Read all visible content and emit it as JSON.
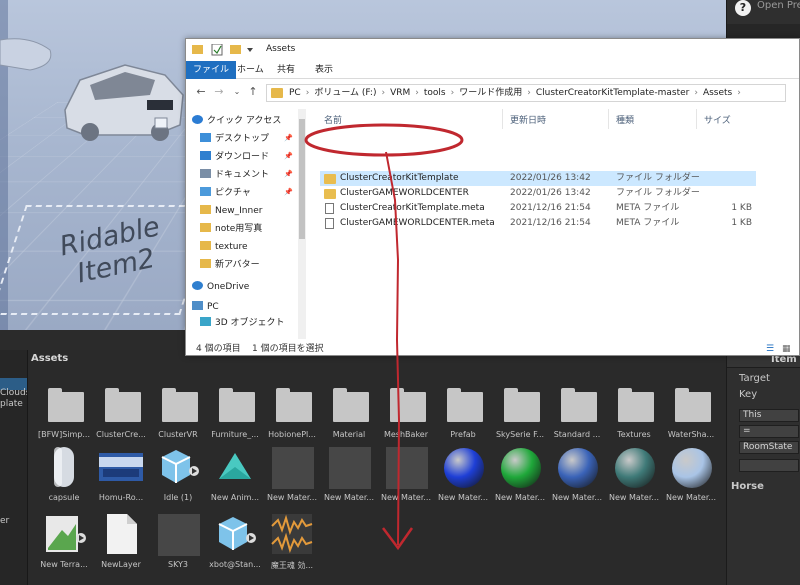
{
  "scene": {
    "ridable_label_line1": "Ridable",
    "ridable_label_line2": "Item2"
  },
  "inspector": {
    "help_icon": "?",
    "open_prefab": "Open Prefab",
    "item_header": "Item Lo",
    "target_label": "Target",
    "key_label": "Key",
    "this_field": "This",
    "equals_field": "=",
    "roomstate_field": "RoomState",
    "horse_header": "Horse"
  },
  "hierarchy": {
    "items": [
      "Clouds",
      "plate",
      "er"
    ]
  },
  "explorer": {
    "title": "Assets",
    "ribbon_tabs": [
      "ファイル",
      "ホーム",
      "共有",
      "表示"
    ],
    "address_path": [
      "PC",
      "ボリューム (F:)",
      "VRM",
      "tools",
      "ワールド作成用",
      "ClusterCreatorKitTemplate-master",
      "Assets"
    ],
    "nav_items": [
      {
        "label": "クイック アクセス",
        "icon": "star-icon",
        "pinned": false
      },
      {
        "label": "デスクトップ",
        "icon": "desktop-icon",
        "pinned": true
      },
      {
        "label": "ダウンロード",
        "icon": "download-icon",
        "pinned": true
      },
      {
        "label": "ドキュメント",
        "icon": "document-icon",
        "pinned": true
      },
      {
        "label": "ピクチャ",
        "icon": "picture-icon",
        "pinned": true
      },
      {
        "label": "New_Inner",
        "icon": "folder-icon",
        "pinned": false
      },
      {
        "label": "note用写真",
        "icon": "folder-icon",
        "pinned": false
      },
      {
        "label": "texture",
        "icon": "folder-icon",
        "pinned": false
      },
      {
        "label": "新アバター",
        "icon": "folder-icon",
        "pinned": false
      },
      {
        "label": "OneDrive",
        "icon": "cloud-icon",
        "pinned": false
      },
      {
        "label": "PC",
        "icon": "pc-icon",
        "pinned": false
      },
      {
        "label": "3D オブジェクト",
        "icon": "3d-objects-icon",
        "pinned": false
      }
    ],
    "columns": {
      "name": "名前",
      "date": "更新日時",
      "type": "種類",
      "size": "サイズ"
    },
    "files": [
      {
        "name": "ClusterCreatorKitTemplate",
        "date": "2022/01/26 13:42",
        "type": "ファイル フォルダー",
        "size": "",
        "kind": "folder"
      },
      {
        "name": "ClusterGAMEWORLDCENTER",
        "date": "2022/01/26 13:42",
        "type": "ファイル フォルダー",
        "size": "",
        "kind": "folder"
      },
      {
        "name": "ClusterCreatorKitTemplate.meta",
        "date": "2021/12/16 21:54",
        "type": "META ファイル",
        "size": "1 KB",
        "kind": "file"
      },
      {
        "name": "ClusterGAMEWORLDCENTER.meta",
        "date": "2021/12/16 21:54",
        "type": "META ファイル",
        "size": "1 KB",
        "kind": "file"
      }
    ],
    "status_count": "4 個の項目",
    "status_selected": "1 個の項目を選択"
  },
  "assets": {
    "title": "Assets",
    "row1": [
      "[BFW]Simp...",
      "ClusterCre...",
      "ClusterVR",
      "Furniture_...",
      "HobionePl...",
      "Material",
      "MeshBaker",
      "Prefab",
      "SkySerie F...",
      "Standard ...",
      "Textures",
      "WaterSha..."
    ],
    "row2": [
      "capsule",
      "Homu-Ro...",
      "Idle (1)",
      "New Anim...",
      "New Mater...",
      "New Mater...",
      "New Mater...",
      "New Mater...",
      "New Mater...",
      "New Mater...",
      "New Mater...",
      "New Mater..."
    ],
    "row3": [
      "New Terra...",
      "NewLayer",
      "SKY3",
      "xbot@Stan...",
      "魔王魂 効..."
    ],
    "sphere_colors": [
      "#1e3fd6",
      "#1fa83a",
      "#3a63b8",
      "#3f7a78",
      "#a9c4e6"
    ]
  },
  "annotation_color": "#c0282f"
}
